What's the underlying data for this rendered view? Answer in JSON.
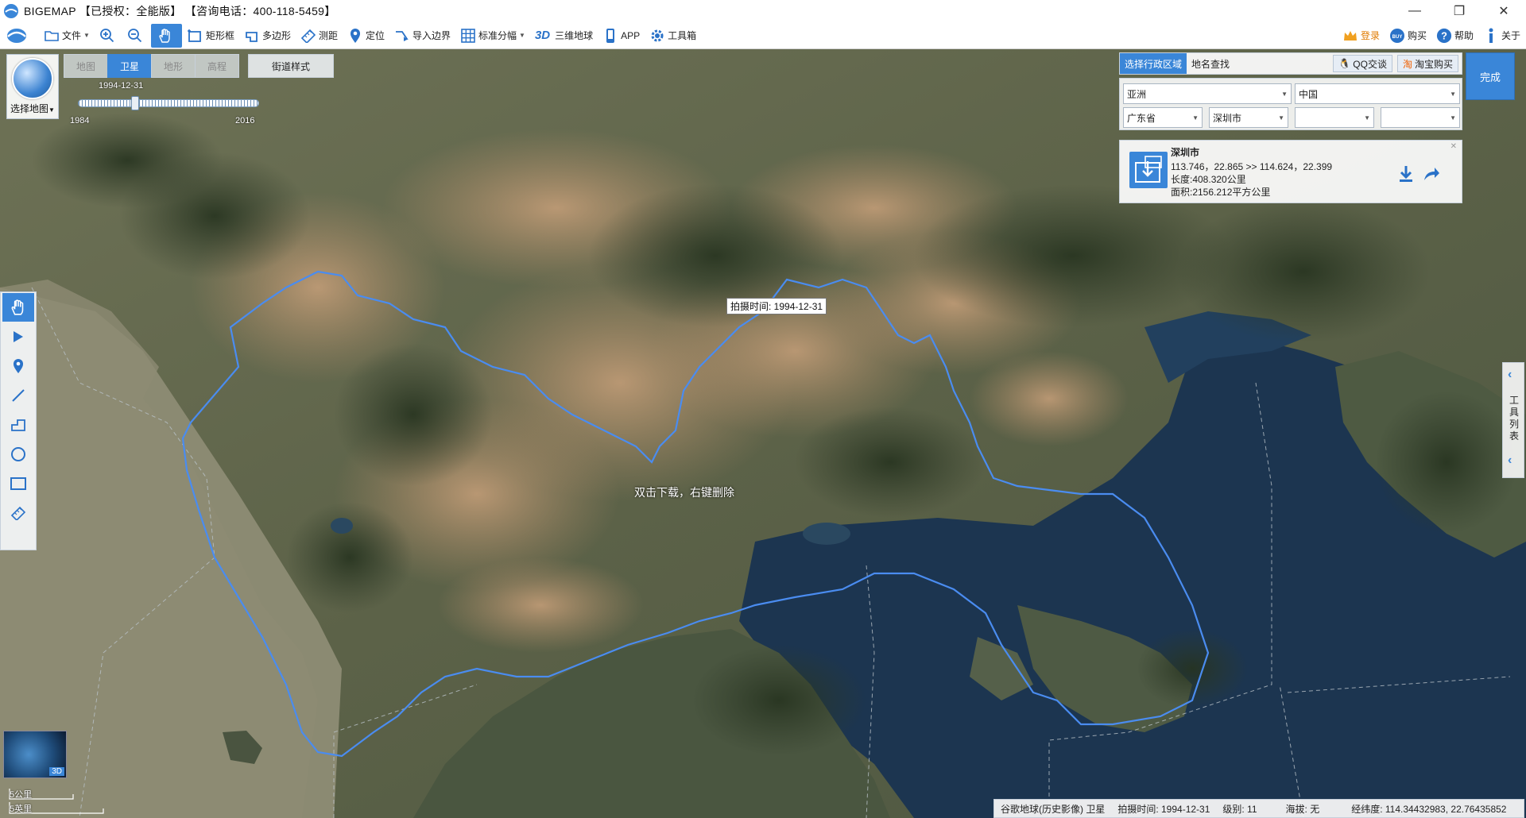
{
  "window": {
    "title": "BIGEMAP 【已授权：全能版】 【咨询电话：400-118-5459】",
    "minimize": "—",
    "maximize": "❐",
    "close": "✕"
  },
  "toolbar": {
    "file": "文件",
    "zoom_in": "",
    "zoom_out": "",
    "pan": "",
    "rectangle": "矩形框",
    "polygon": "多边形",
    "measure": "测距",
    "locate": "定位",
    "import_boundary": "导入边界",
    "standard_sheet": "标准分幅",
    "threeD_prefix": "3D",
    "threeD_globe": "三维地球",
    "app": "APP",
    "toolbox": "工具箱",
    "login": "登录",
    "buy": "购买",
    "help": "帮助",
    "about": "关于"
  },
  "map_type": {
    "select_map": "选择地图",
    "tabs": [
      "地图",
      "卫星",
      "地形",
      "高程"
    ],
    "active_tab": "卫星",
    "street_style": "街道样式"
  },
  "time_slider": {
    "current": "1994-12-31",
    "min": "1984",
    "max": "2016"
  },
  "left_tools": [
    "pan-hand-icon",
    "arrow-icon",
    "marker-icon",
    "line-icon",
    "polyline-icon",
    "circle-icon",
    "rectangle-icon",
    "ruler-icon"
  ],
  "right_panel": {
    "tab_admin": "选择行政区域",
    "tab_search": "地名查找",
    "qq": "QQ交谈",
    "taobao": "淘宝购买",
    "done": "完成",
    "continent": "亚洲",
    "country": "中国",
    "province": "广东省",
    "city": "深圳市",
    "district": "",
    "town": "",
    "info": {
      "name": "深圳市",
      "coords": "113.746，22.865 >> 114.624，22.399",
      "length": "长度:408.320公里",
      "area": "面积:2156.212平方公里"
    }
  },
  "right_handle": {
    "label": "工具列表"
  },
  "map": {
    "tooltip": "拍摄时间: 1994-12-31",
    "hint": "双击下载，右键删除"
  },
  "mini_map": {
    "label": "3D"
  },
  "scale": {
    "km": "5公里",
    "mi": "5英里"
  },
  "status": {
    "source": "谷歌地球(历史影像) 卫星",
    "capture": "拍摄时间: 1994-12-31",
    "level": "级别:  11",
    "altitude": "海拔: 无",
    "latlng": "经纬度:  114.34432983, 22.76435852"
  },
  "colors": {
    "accent": "#3a86d8",
    "boundary": "#4a8cf0",
    "sea": "#1c3550",
    "estuary": "#8b8a72"
  }
}
